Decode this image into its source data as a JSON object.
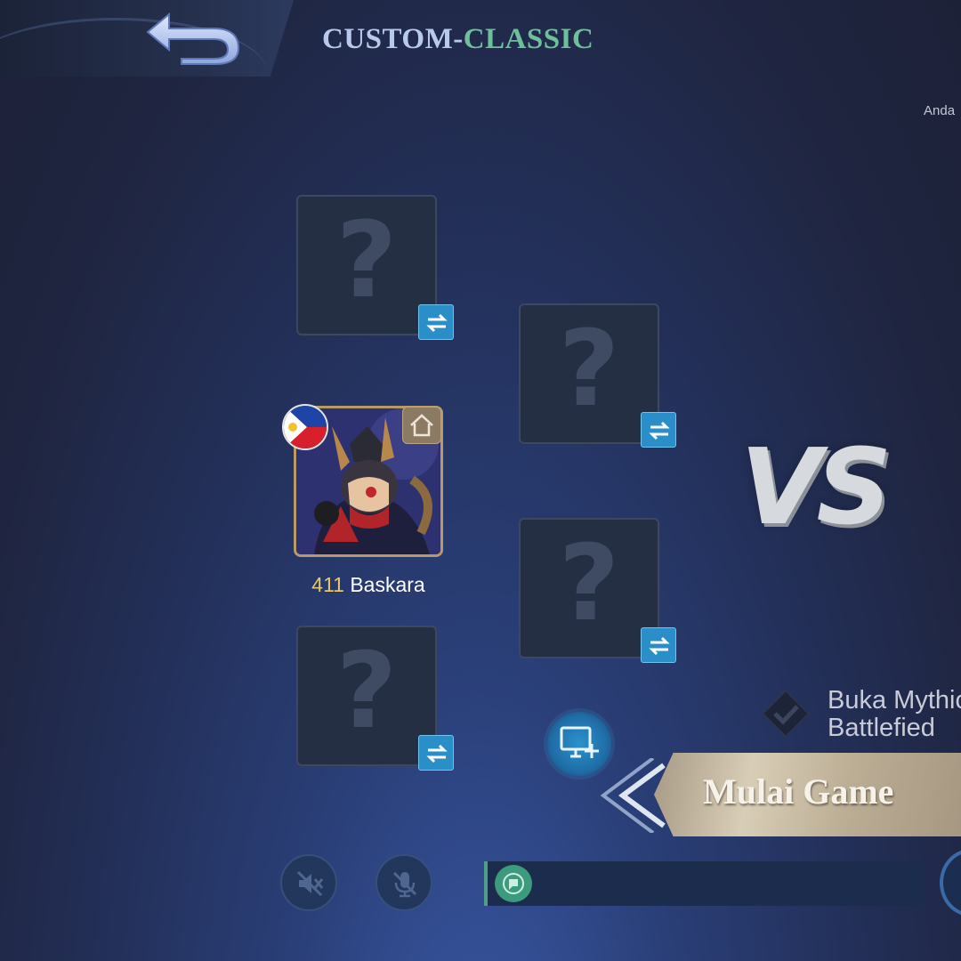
{
  "header": {
    "title_part1": "CUSTOM-",
    "title_part2": "CLASSIC",
    "corner_text": "Anda"
  },
  "icons": {
    "back": "back-arrow-icon",
    "swap": "swap-icon",
    "unknown": "question-mark-icon",
    "flag": "philippines-flag-icon",
    "home": "home-icon",
    "mythic": "check-diamond-icon",
    "pc": "monitor-plus-icon",
    "speaker": "speaker-muted-icon",
    "mic": "mic-muted-icon",
    "chat": "chat-icon"
  },
  "team": {
    "empty_slot_symbol": "?",
    "player": {
      "level": "411",
      "name": "Baskara"
    }
  },
  "vs_label": "VS",
  "mythic_notice": {
    "line1": "Buka Mythic",
    "line2": "Battlefied"
  },
  "start_button_label": "Mulai Game",
  "colors": {
    "accent_blue": "#2a8fc8",
    "title_silver": "#b9c9ec",
    "title_green": "#6cc09a",
    "level_gold": "#e8c66a",
    "chat_green": "#3c9a7d"
  }
}
